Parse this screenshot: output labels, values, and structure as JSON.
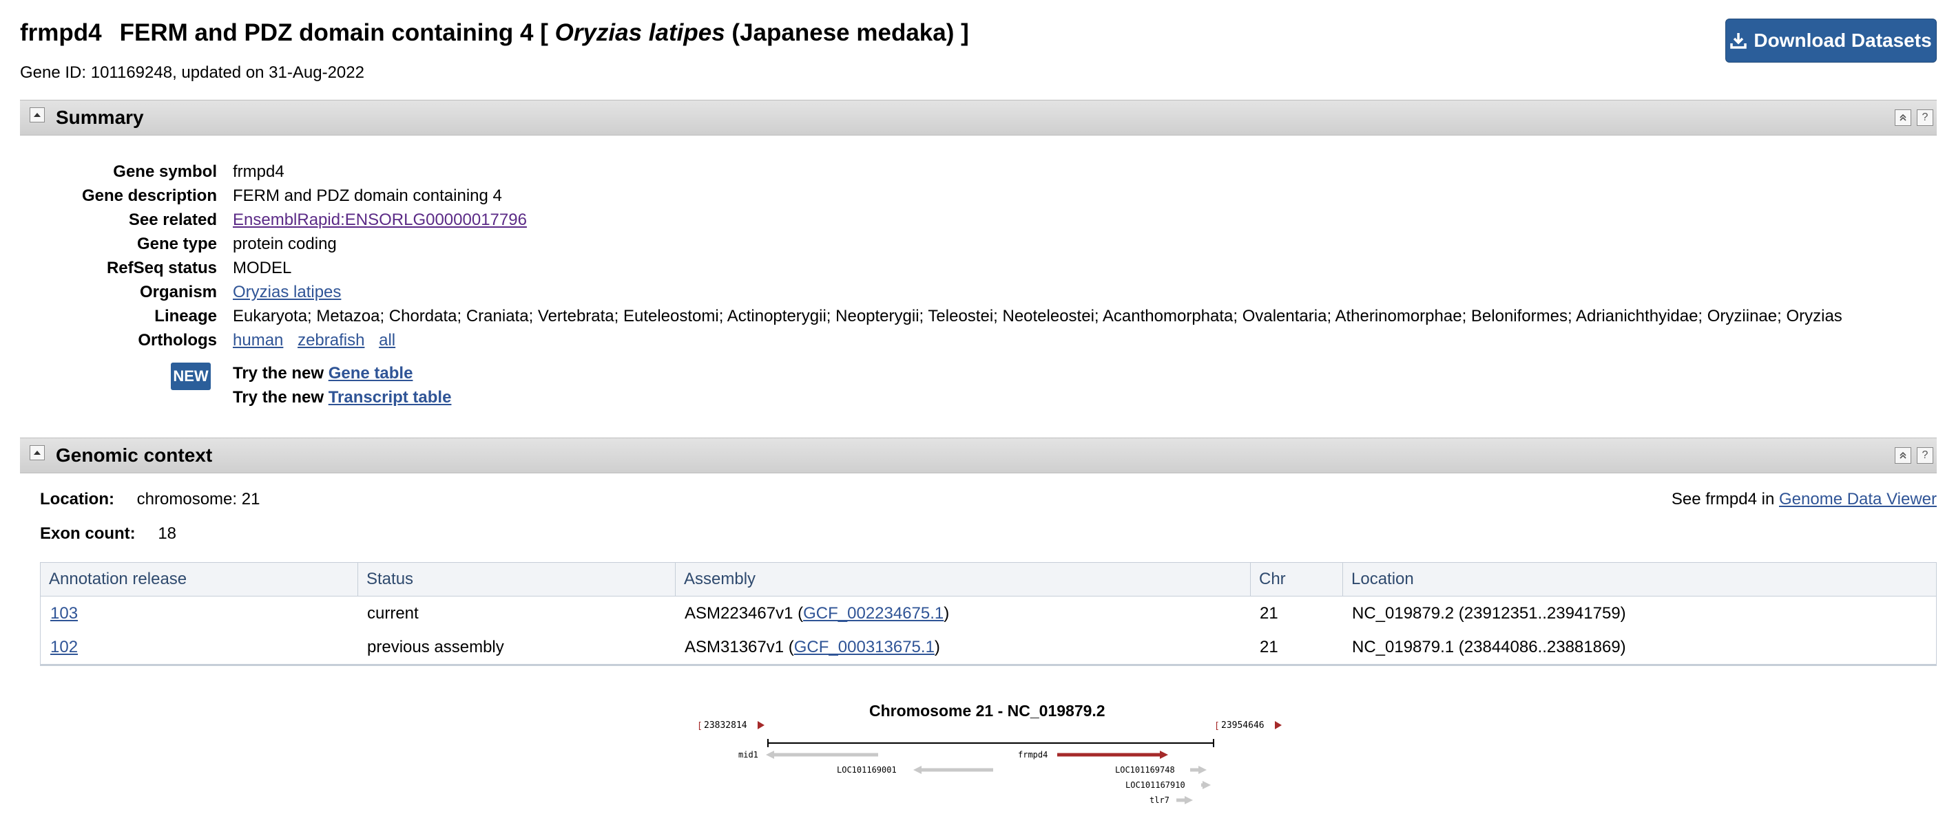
{
  "header": {
    "gene_symbol": "frmpd4",
    "gene_name": "FERM and PDZ domain containing 4",
    "species_open": "[",
    "species_italic": "Oryzias latipes",
    "species_common": "(Japanese medaka)",
    "species_close": "]",
    "gene_id_line": "Gene ID: 101169248, updated on 31-Aug-2022",
    "download_label": "Download Datasets"
  },
  "summary": {
    "title": "Summary",
    "fields": [
      {
        "label": "Gene symbol",
        "value": "frmpd4"
      },
      {
        "label": "Gene description",
        "value": "FERM and PDZ domain containing 4"
      },
      {
        "label": "See related",
        "value": "EnsemblRapid:ENSORLG00000017796"
      },
      {
        "label": "Gene type",
        "value": "protein coding"
      },
      {
        "label": "RefSeq status",
        "value": "MODEL"
      },
      {
        "label": "Organism",
        "value": "Oryzias latipes"
      },
      {
        "label": "Lineage",
        "value": "Eukaryota; Metazoa; Chordata; Craniata; Vertebrata; Euteleostomi; Actinopterygii; Neopterygii; Teleostei; Neoteleostei; Acanthomorphata; Ovalentaria; Atherinomorphae; Beloniformes; Adrianichthyidae; Oryziinae; Oryzias"
      },
      {
        "label": "Orthologs",
        "value": ""
      }
    ],
    "orthologs": [
      "human",
      "zebrafish",
      "all"
    ],
    "new_badge": "NEW",
    "try_prefix": "Try the new",
    "gene_table_link": "Gene table",
    "transcript_table_link": "Transcript table"
  },
  "genomic": {
    "title": "Genomic context",
    "location_label": "Location:",
    "location_value": "chromosome: 21",
    "exon_label": "Exon count:",
    "exon_value": "18",
    "see_prefix": "See frmpd4 in",
    "gdv_link": "Genome Data Viewer",
    "table": {
      "headers": [
        "Annotation release",
        "Status",
        "Assembly",
        "Chr",
        "Location"
      ],
      "rows": [
        {
          "release": "103",
          "status": "current",
          "assembly_name": "ASM223467v1 (",
          "assembly_acc": "GCF_002234675.1",
          "assembly_close": ")",
          "chr": "21",
          "location": "NC_019879.2 (23912351..23941759)"
        },
        {
          "release": "102",
          "status": "previous assembly",
          "assembly_name": "ASM31367v1 (",
          "assembly_acc": "GCF_000313675.1",
          "assembly_close": ")",
          "chr": "21",
          "location": "NC_019879.1 (23844086..23881869)"
        }
      ]
    },
    "chart": {
      "title": "Chromosome 21 - NC_019879.2",
      "left_coord": "23832814",
      "right_coord": "23954646",
      "genes": [
        "mid1",
        "LOC101169001",
        "frmpd4",
        "LOC101169748",
        "LOC101167910",
        "tlr7"
      ]
    }
  },
  "colors": {
    "link": "#2f5496",
    "visited_link": "#5b2a86",
    "button": "#2b5e9a",
    "highlight_gene": "#a52a2a",
    "other_gene": "#c8c8c8"
  }
}
